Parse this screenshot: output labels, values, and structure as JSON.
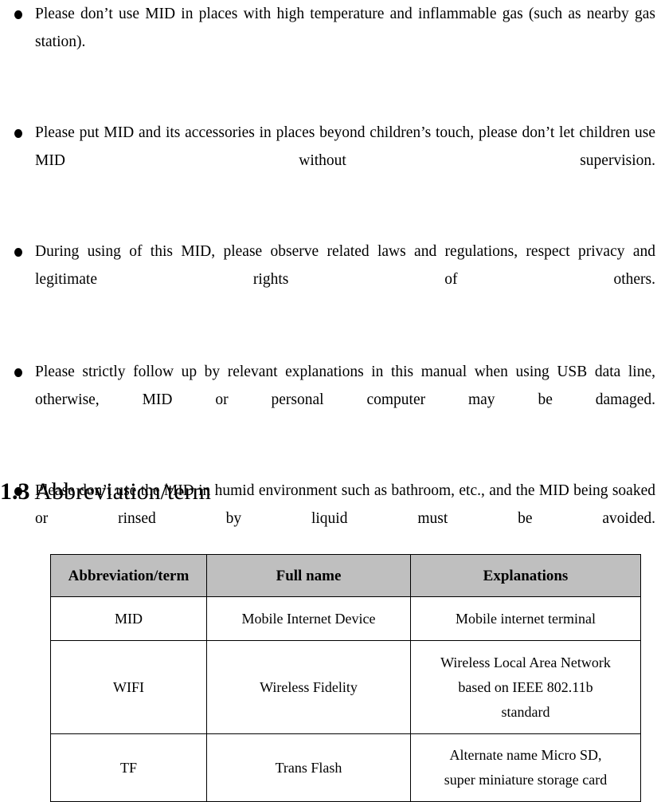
{
  "document": {
    "bullets": [
      {
        "marker": "bullet",
        "text": "Please don’t use MID in places with high temperature and inflammable gas (such as nearby gas station)."
      },
      {
        "marker": "bullet",
        "text": "Please put MID and its accessories in places beyond children’s touch, please don’t let children use MID without supervision."
      },
      {
        "marker": "bullet",
        "text": "During using of this MID, please observe related laws and regulations, respect privacy and legitimate rights of others."
      },
      {
        "marker": "bullet",
        "text": "Please strictly follow up by relevant explanations in this manual when using USB data line, otherwise, MID or personal computer may be damaged."
      },
      {
        "marker": "bullet",
        "text": "Please don’t use the MID in humid environment such as bathroom, etc., and the MID being soaked or rinsed by liquid must be avoided."
      }
    ],
    "heading": {
      "number": "1.3",
      "title": "Abbreviation/term"
    },
    "table": {
      "headers": [
        "Abbreviation/term",
        "Full name",
        "Explanations"
      ],
      "header_background": "#bfbfbf",
      "rows": [
        {
          "abbreviation": "MID",
          "full_name": "Mobile Internet Device",
          "explanation": "Mobile internet terminal",
          "explanation_lines": [
            "Mobile internet terminal"
          ]
        },
        {
          "abbreviation": "WIFI",
          "full_name": "Wireless Fidelity",
          "explanation": "Wireless Local Area Network based on IEEE 802.11b standard",
          "explanation_lines": [
            "Wireless Local Area Network",
            "based on IEEE 802.11b",
            "standard"
          ]
        },
        {
          "abbreviation": "TF",
          "full_name": "Trans Flash",
          "explanation": "Alternate name Micro SD, super miniature storage card",
          "explanation_lines": [
            "Alternate name Micro SD,",
            "super miniature storage card"
          ]
        }
      ]
    }
  }
}
